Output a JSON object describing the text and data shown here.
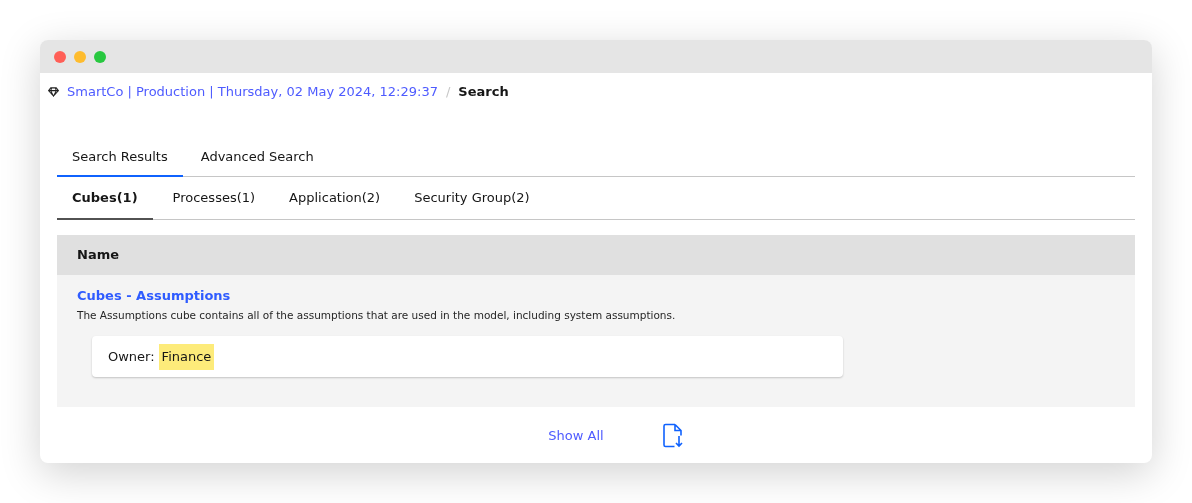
{
  "breadcrumb": {
    "path": "SmartCo | Production | Thursday, 02 May 2024, 12:29:37",
    "separator": "/",
    "current": "Search"
  },
  "tabs": [
    {
      "label": "Search Results",
      "selected": true
    },
    {
      "label": "Advanced Search",
      "selected": false
    }
  ],
  "subtabs": [
    {
      "label": "Cubes(1)",
      "selected": true
    },
    {
      "label": "Processes(1)",
      "selected": false
    },
    {
      "label": "Application(2)",
      "selected": false
    },
    {
      "label": "Security Group(2)",
      "selected": false
    }
  ],
  "table": {
    "columns": [
      "Name"
    ],
    "rows": [
      {
        "title": "Cubes - Assumptions",
        "description": "The Assumptions cube contains all of the assumptions that are used in the model, including system assumptions.",
        "owner_label": "Owner:",
        "owner": "Finance"
      }
    ]
  },
  "footer": {
    "show_all": "Show All"
  }
}
